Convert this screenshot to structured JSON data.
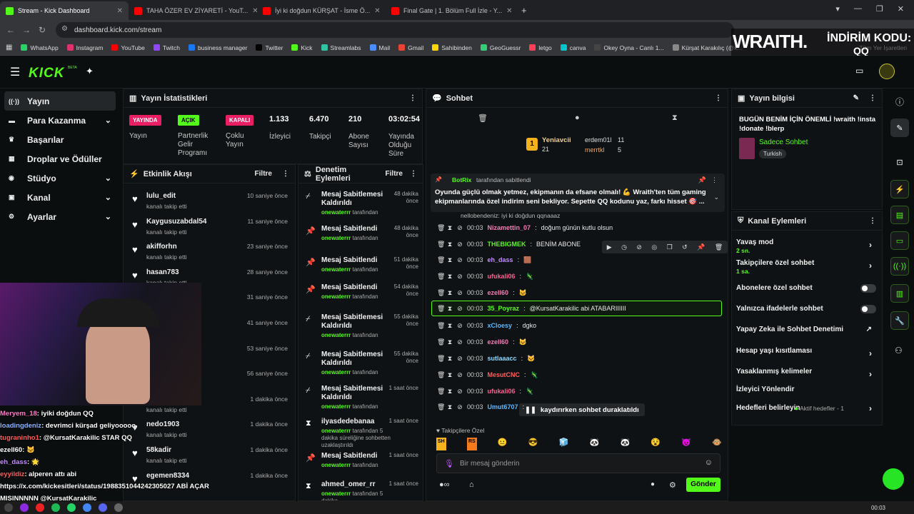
{
  "browser": {
    "tabs": [
      {
        "label": "Stream - Kick Dashboard",
        "color": "#53fc18",
        "active": true
      },
      {
        "label": "TAHA ÖZER EV ZİYARETİ - YouT...",
        "color": "#ff0000"
      },
      {
        "label": "İyi ki doğdun KÜRŞAT - İsme Ö...",
        "color": "#ff0000"
      },
      {
        "label": "Final Gate | 1. Bölüm Full İzle - Y...",
        "color": "#ff0000"
      }
    ],
    "url": "dashboard.kick.com/stream",
    "bookmarks": [
      "WhatsApp",
      "Instagram",
      "YouTube",
      "Twitch",
      "business manager",
      "Twitter",
      "Kick",
      "Streamlabs",
      "Mail",
      "Gmail",
      "Sahibinden",
      "GeoGuessr",
      "letgo",
      "canva",
      "Okey Oyna - Canlı 1...",
      "Kürşat Karakılıç (@k..."
    ],
    "bookmarks_end": "Tüm Yer İşaretleri"
  },
  "promo": {
    "brand": "WRAITH.",
    "line1": "İNDİRİM KODU:",
    "line2": "QQ"
  },
  "brand": {
    "logo": "KICK",
    "beta": "BETA"
  },
  "sidebar": {
    "items": [
      {
        "label": "Yayın",
        "icon": "broadcast-icon",
        "glyph": "((·))",
        "active": true
      },
      {
        "label": "Para Kazanma",
        "icon": "money-icon",
        "glyph": "▬",
        "chev": true
      },
      {
        "label": "Başarılar",
        "icon": "trophy-icon",
        "glyph": "♛"
      },
      {
        "label": "Droplar ve Ödüller",
        "icon": "gift-icon",
        "glyph": "▦"
      },
      {
        "label": "Stüdyo",
        "icon": "studio-icon",
        "glyph": "◉",
        "chev": true
      },
      {
        "label": "Kanal",
        "icon": "channel-icon",
        "glyph": "▣",
        "chev": true
      },
      {
        "label": "Ayarlar",
        "icon": "settings-icon",
        "glyph": "⚙",
        "chev": true
      }
    ]
  },
  "stats": {
    "title": "Yayın İstatistikleri",
    "stream_badge": "YAYINDA",
    "stream_label": "Yayın",
    "partner_badge": "AÇIK",
    "partner_label": "Partnerlik Gelir Programı",
    "multi_badge": "KAPALI",
    "multi_label": "Çoklu Yayın",
    "viewers": "1.133",
    "viewers_label": "İzleyici",
    "followers": "6.470",
    "followers_label": "Takipçi",
    "subs": "210",
    "subs_label": "Abone Sayısı",
    "uptime": "03:02:54",
    "uptime_label": "Yayında Olduğu Süre"
  },
  "activity": {
    "title": "Etkinlik Akışı",
    "filter": "Filtre",
    "items": [
      {
        "name": "lulu_edit",
        "text": "kanalı takip etti",
        "time": "10 saniye önce"
      },
      {
        "name": "Kaygusuzabdal54",
        "text": "kanalı takip etti",
        "time": "11 saniye önce"
      },
      {
        "name": "akifforhn",
        "text": "kanalı takip etti",
        "time": "23 saniye önce"
      },
      {
        "name": "hasan783",
        "text": "kanalı takip etti",
        "time": "28 saniye önce"
      },
      {
        "name": "",
        "text": "",
        "time": "31 saniye önce"
      },
      {
        "name": "",
        "text": "",
        "time": "41 saniye önce"
      },
      {
        "name": "",
        "text": "",
        "time": "53 saniye önce"
      },
      {
        "name": "",
        "text": "",
        "time": "56 saniye önce"
      },
      {
        "name": "",
        "text": "kanalı takip etti",
        "time": "1 dakika önce"
      },
      {
        "name": "nedo1903",
        "text": "kanalı takip etti",
        "time": "1 dakika önce"
      },
      {
        "name": "58kadir",
        "text": "kanalı takip etti",
        "time": "1 dakika önce"
      },
      {
        "name": "egemen8334",
        "text": "",
        "time": "1 dakika önce"
      }
    ]
  },
  "moderation": {
    "title": "Denetim Eylemleri",
    "filter": "Filtre",
    "items": [
      {
        "title": "Mesaj Sabitlemesi Kaldırıldı",
        "by": "onewaterrr",
        "suffix": "tarafından",
        "time": "48 dakika önce",
        "icon": "unpin-icon"
      },
      {
        "title": "Mesaj Sabitlendi",
        "by": "onewaterrr",
        "suffix": "tarafından",
        "time": "48 dakika önce",
        "icon": "pin-icon"
      },
      {
        "title": "Mesaj Sabitlendi",
        "by": "onewaterrr",
        "suffix": "tarafından",
        "time": "51 dakika önce",
        "icon": "pin-icon"
      },
      {
        "title": "Mesaj Sabitlendi",
        "by": "onewaterrr",
        "suffix": "tarafından",
        "time": "54 dakika önce",
        "icon": "pin-icon"
      },
      {
        "title": "Mesaj Sabitlemesi Kaldırıldı",
        "by": "onewaterrr",
        "suffix": "tarafından",
        "time": "55 dakika önce",
        "icon": "unpin-icon"
      },
      {
        "title": "Mesaj Sabitlemesi Kaldırıldı",
        "by": "onewaterrr",
        "suffix": "tarafından",
        "time": "55 dakika önce",
        "icon": "unpin-icon"
      },
      {
        "title": "Mesaj Sabitlemesi Kaldırıldı",
        "by": "onewaterrr",
        "suffix": "tarafından",
        "time": "1 saat önce",
        "icon": "unpin-icon"
      },
      {
        "title": "ilyasdedebanaa",
        "by": "onewaterrr",
        "suffix": "tarafından 5 dakika süreliğine sohbetten uzaklaştırıldı",
        "time": "1 saat önce",
        "icon": "timeout-icon"
      },
      {
        "title": "Mesaj Sabitlendi",
        "by": "onewaterrr",
        "suffix": "tarafından",
        "time": "1 saat önce",
        "icon": "pin-icon"
      },
      {
        "title": "ahmed_omer_rr",
        "by": "onewaterrr",
        "suffix": "tarafından 5 dakika",
        "time": "1 saat önce",
        "icon": "timeout-icon"
      }
    ]
  },
  "chat": {
    "title": "Sohbet",
    "gifters": {
      "top": "Yeniavcii",
      "top_count": "21",
      "second": "erdem01l",
      "second_count": "11",
      "third": "merrtkl",
      "third_count": "5"
    },
    "pinned": {
      "by": "BotRix",
      "by_suffix": "tarafından sabitlendi",
      "text": "Oyunda güçlü olmak yetmez, ekipmanın da efsane olmalı! 💪 Wraith'ten tüm gaming ekipmanlarında özel indirim seni bekliyor. Sepette QQ kodunu yaz, farkı hisset 🎯 ..."
    },
    "partial": "nellobendeniz: iyi ki doğdun qqnaaaz",
    "messages": [
      {
        "time": "00:03",
        "user": "Nizamettin_07",
        "color": "#f27eb6",
        "text": "doğum günün kutlu olsun"
      },
      {
        "time": "00:03",
        "user": "THEBIGMEK",
        "color": "#53fc18",
        "text": "BENİM ABONE"
      },
      {
        "time": "00:03",
        "user": "eh_dass",
        "color": "#c58cff",
        "text": "🟫"
      },
      {
        "time": "00:03",
        "user": "ufukali06",
        "color": "#ff5d8f",
        "text": "🦎"
      },
      {
        "time": "00:03",
        "user": "ezell60",
        "color": "#f27eb6",
        "text": "🐱"
      },
      {
        "time": "00:03",
        "user": "35_Poyraz",
        "color": "#53fc18",
        "text": "@KursatKarakilic abi ATABARIIIIII",
        "highlight": true
      },
      {
        "time": "00:03",
        "user": "xCloesy",
        "color": "#5ab8ff",
        "text": "dgko"
      },
      {
        "time": "00:03",
        "user": "ezell60",
        "color": "#f27eb6",
        "text": "🐱"
      },
      {
        "time": "00:03",
        "user": "sutlaaacc",
        "color": "#8ad7ff",
        "text": "🐱"
      },
      {
        "time": "00:03",
        "user": "MesutCNC",
        "color": "#ff5d5d",
        "text": "🦎"
      },
      {
        "time": "00:03",
        "user": "ufukali06",
        "color": "#ff5d8f",
        "text": "🦎"
      },
      {
        "time": "00:03",
        "user": "Umut6707",
        "color": "#5ab8ff",
        "text": ""
      }
    ],
    "paused": "kaydırırken sohbet duraklatıldı",
    "followers_only": "Takipçilere Özel",
    "input_placeholder": "Bir mesaj gönderin",
    "send": "Gönder"
  },
  "stream_info": {
    "title": "Yayın bilgisi",
    "stream_title": "BUGÜN BENİM İÇİN ÖNEMLİ !wraith !insta !donate !blerp",
    "category": "Sadece Sohbet",
    "tag": "Turkish"
  },
  "channel_actions": {
    "title": "Kanal Eylemleri",
    "items": [
      {
        "label": "Yavaş mod",
        "sub": "2 sn.",
        "type": "chev"
      },
      {
        "label": "Takipçilere özel sohbet",
        "sub": "1 sa.",
        "type": "chev"
      },
      {
        "label": "Abonelere özel sohbet",
        "type": "toggle"
      },
      {
        "label": "Yalnızca ifadelerle sohbet",
        "type": "toggle"
      },
      {
        "label": "Yapay Zeka ile Sohbet Denetimi",
        "type": "ext"
      },
      {
        "label": "Hesap yaşı kısıtlaması",
        "type": "chev"
      },
      {
        "label": "Yasaklanmış kelimeler",
        "type": "chev"
      },
      {
        "label": "İzleyici Yönlendir",
        "type": "none"
      },
      {
        "label": "Hedefleri belirleyin",
        "type": "goal",
        "sub": "Aktif hedefler - 1"
      }
    ]
  },
  "stream_overlay": {
    "lines": [
      {
        "user": "Meryem_18",
        "color": "#ff79c6",
        "text": ": iyiki doğdun QQ"
      },
      {
        "user": "loadingdeniz",
        "color": "#8ab4ff",
        "text": ": devrimci kürşad geliyooooo"
      },
      {
        "user": "tugraninho1",
        "color": "#ff5d5d",
        "text": ": @KursatKarakilic STAR QQ"
      },
      {
        "user": "ezell60",
        "color": "#ffffff",
        "text": ": 🐱"
      },
      {
        "user": "eh_dass",
        "color": "#c58cff",
        "text": ": 🌟"
      },
      {
        "user": "eyyildiz",
        "color": "#ff5d5d",
        "text": ": alperen attı abi"
      },
      {
        "user": "",
        "color": "#ffffff",
        "text": "https://x.com/kickesitleri/status/1988351044242305027 ABİ AÇAR"
      },
      {
        "user": "",
        "color": "#ffffff",
        "text": "MISINNNNN @KursatKarakilic"
      }
    ]
  },
  "taskbar": {
    "clock": "00:03"
  },
  "colors": {
    "accent": "#53fc18",
    "bg": "#0b0e0f",
    "panel": "#0f1214",
    "live": "#e91e63"
  }
}
